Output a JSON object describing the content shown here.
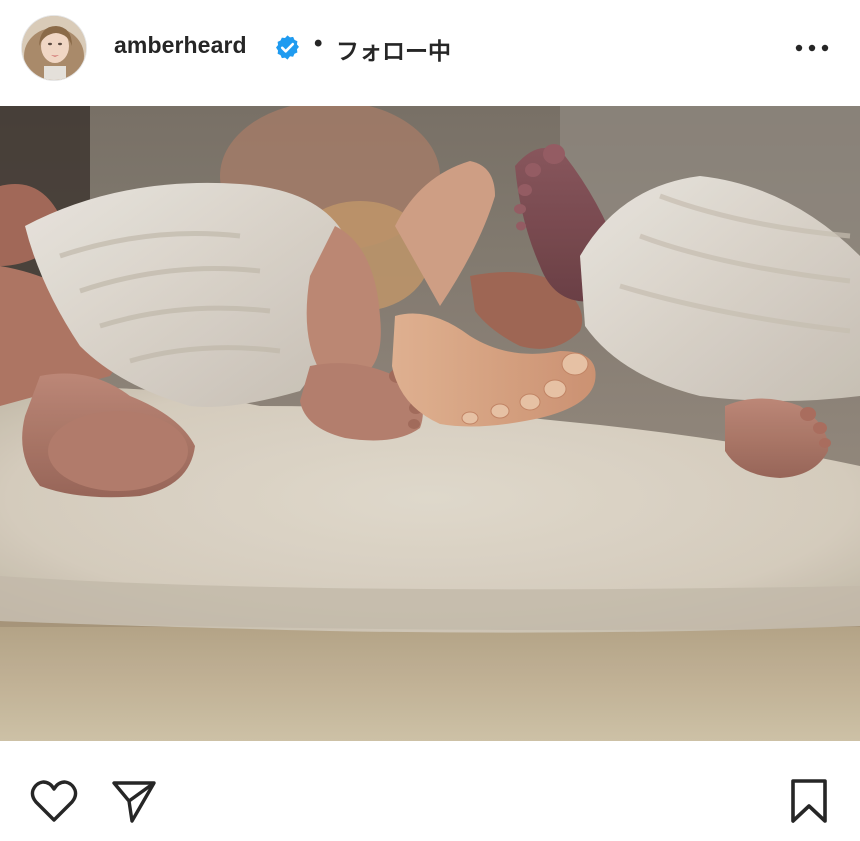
{
  "post": {
    "author": {
      "username": "amberheard",
      "verified": true,
      "separator": "•",
      "follow_status": "フォロー中",
      "avatar_icon": "profile-avatar"
    },
    "header_actions": {
      "more_icon": "more-horizontal-icon"
    },
    "photo": {
      "subject_icon": "post-photo"
    },
    "actions": {
      "like_icon": "heart-icon",
      "share_icon": "send-icon",
      "save_icon": "bookmark-icon"
    },
    "colors": {
      "text": "#262626",
      "verified_badge": "#1f9bf0",
      "background": "#ffffff"
    }
  }
}
